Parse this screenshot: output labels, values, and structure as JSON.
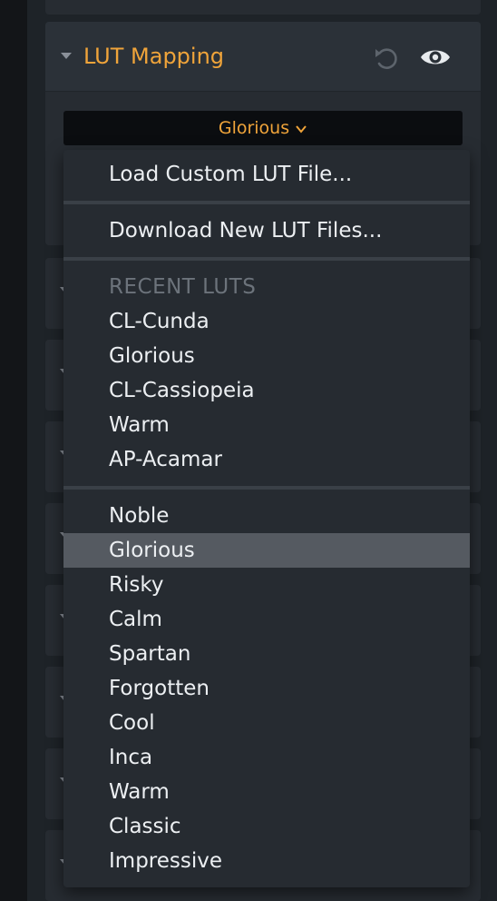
{
  "panel": {
    "title": "LUT Mapping",
    "selected_lut": "Glorious",
    "accent_color": "#f0a43a",
    "icons": {
      "reset": "reset-icon",
      "visibility": "eye-icon",
      "expand": "caret-down-icon",
      "dropdown": "chevron-down-icon"
    }
  },
  "menu": {
    "load_custom": "Load Custom LUT File...",
    "download_new": "Download New LUT Files...",
    "recent_header": "RECENT LUTS",
    "recent": [
      "CL-Cunda",
      "Glorious",
      "CL-Cassiopeia",
      "Warm",
      "AP-Acamar"
    ],
    "luts": [
      "Noble",
      "Glorious",
      "Risky",
      "Calm",
      "Spartan",
      "Forgotten",
      "Cool",
      "Inca",
      "Warm",
      "Classic",
      "Impressive"
    ],
    "highlighted": "Glorious"
  }
}
